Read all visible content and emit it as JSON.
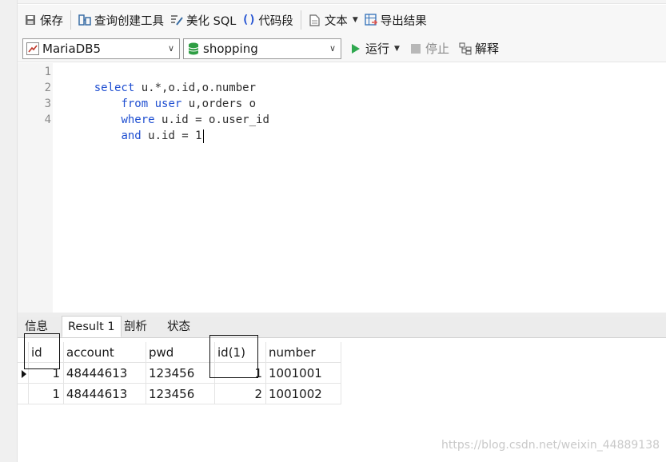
{
  "toolbar": {
    "save": "保存",
    "query_builder": "查询创建工具",
    "beautify_sql": "美化 SQL",
    "code_snippet": "代码段",
    "text": "文本",
    "export_result": "导出结果"
  },
  "selectors": {
    "connection": "MariaDB5",
    "database": "shopping",
    "run": "运行",
    "stop": "停止",
    "explain": "解释"
  },
  "editor": {
    "line_numbers": [
      "1",
      "2",
      "3",
      "4"
    ],
    "lines": [
      [
        {
          "t": "select",
          "k": true
        },
        {
          "t": " u.*,o.id,o.number",
          "k": false
        }
      ],
      [
        {
          "t": "    ",
          "k": false
        },
        {
          "t": "from",
          "k": true
        },
        {
          "t": " ",
          "k": false
        },
        {
          "t": "user",
          "k": true
        },
        {
          "t": " u,orders o",
          "k": false
        }
      ],
      [
        {
          "t": "    ",
          "k": false
        },
        {
          "t": "where",
          "k": true
        },
        {
          "t": " u.id = o.user_id",
          "k": false
        }
      ],
      [
        {
          "t": "    ",
          "k": false
        },
        {
          "t": "and",
          "k": true
        },
        {
          "t": " u.id = 1",
          "k": false
        }
      ]
    ]
  },
  "tabs": {
    "info": "信息",
    "result1": "Result 1",
    "profile": "剖析",
    "status": "状态"
  },
  "results": {
    "columns": [
      "id",
      "account",
      "pwd",
      "id(1)",
      "number"
    ],
    "rows": [
      [
        "1",
        "48444613",
        "123456",
        "1",
        "1001001"
      ],
      [
        "1",
        "48444613",
        "123456",
        "2",
        "1001002"
      ]
    ]
  },
  "watermark": "https://blog.csdn.net/weixin_44889138",
  "colors": {
    "keyword": "#1f4fd1",
    "run_icon": "#2fa84f",
    "db_icon": "#2f9e44"
  }
}
